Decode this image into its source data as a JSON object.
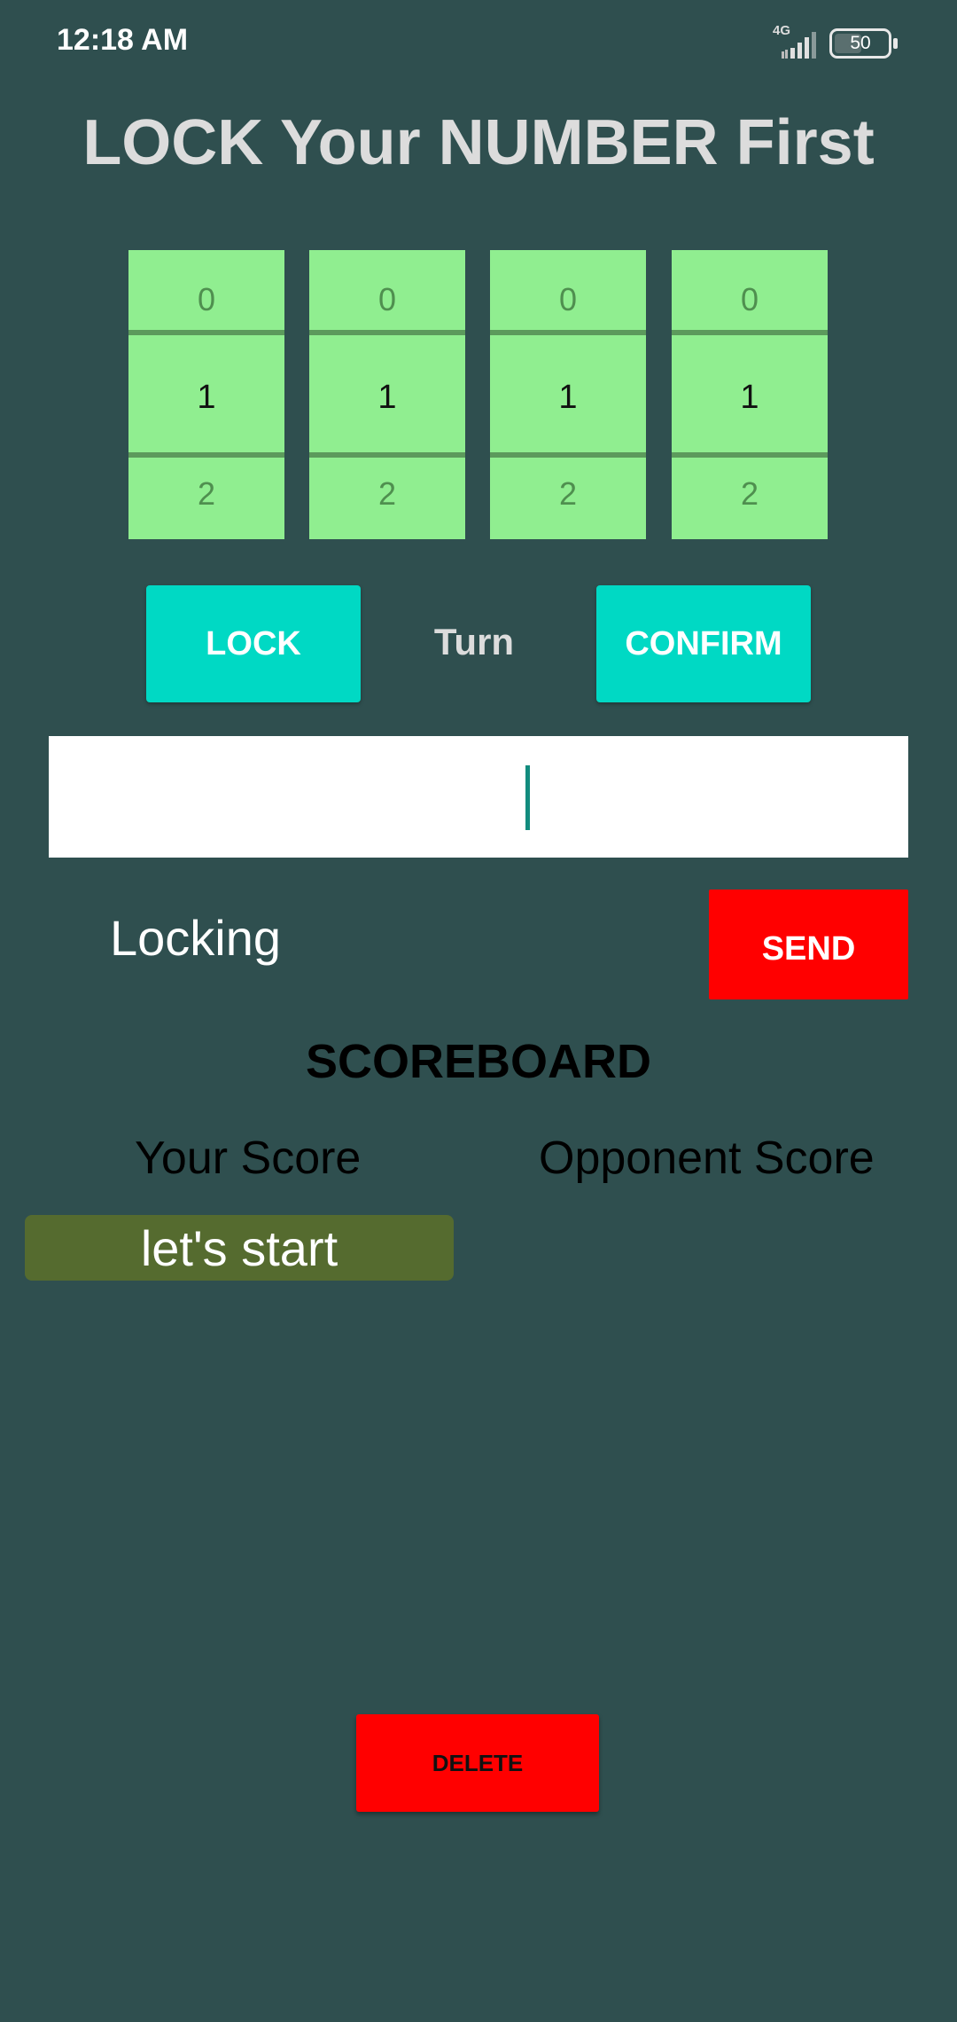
{
  "status_bar": {
    "time": "12:18 AM",
    "network": "4G",
    "battery": "50",
    "icons": [
      "signal-icon",
      "battery-icon"
    ]
  },
  "title": "LOCK Your NUMBER First",
  "pickers": [
    {
      "top": "0",
      "selected": "1",
      "bottom": "2"
    },
    {
      "top": "0",
      "selected": "1",
      "bottom": "2"
    },
    {
      "top": "0",
      "selected": "1",
      "bottom": "2"
    },
    {
      "top": "0",
      "selected": "1",
      "bottom": "2"
    }
  ],
  "actions": {
    "lock_label": "LOCK",
    "turn_label": "Turn",
    "confirm_label": "CONFIRM"
  },
  "guess_input": {
    "value": ""
  },
  "status_text": "Locking",
  "send_label": "SEND",
  "scoreboard": {
    "title": "SCOREBOARD",
    "your_score_label": "Your Score",
    "opponent_score_label": "Opponent Score",
    "entries": [
      "let's start"
    ]
  },
  "delete_label": "DELETE",
  "colors": {
    "background": "#2f4f4f",
    "picker": "#90ee90",
    "accent_teal": "#00d9c4",
    "danger_red": "#ff0000",
    "chip": "#556b2f"
  }
}
